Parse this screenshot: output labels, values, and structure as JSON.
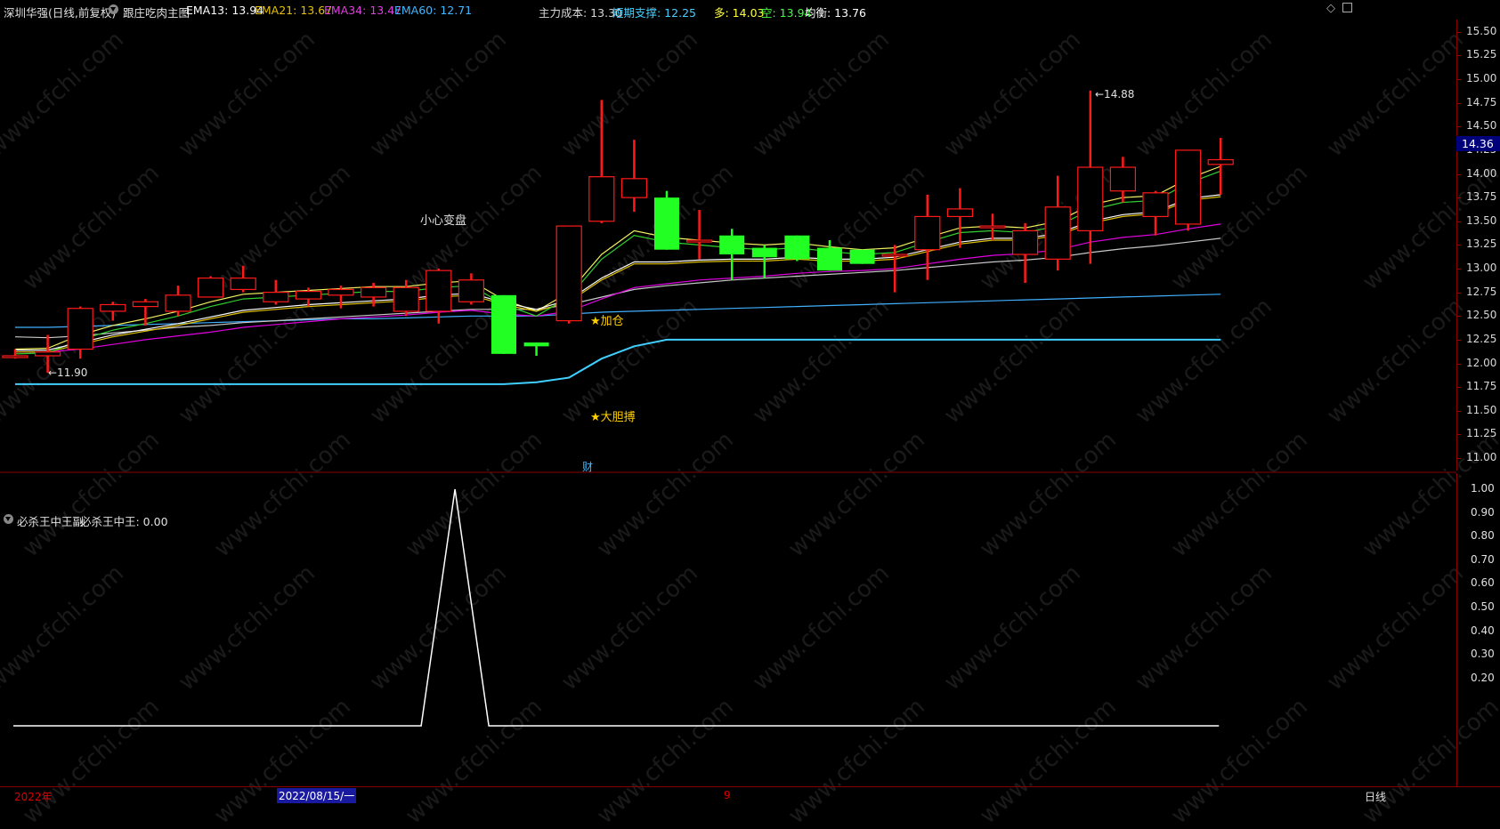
{
  "header": {
    "stock": "深圳华强(日线,前复权)",
    "indicator": "跟庄吃肉主图",
    "ema13": "EMA13: 13.94",
    "ema21": "EMA21: 13.67",
    "ema34": "EMA34: 13.47",
    "ema60": "EMA60: 12.71",
    "main_cost": "主力成本: 13.30",
    "short_support": "短期支撑: 12.25",
    "bull": "多: 14.03",
    "bear": "空: 13.94",
    "balance": "均衡: 13.76"
  },
  "sub_header": {
    "indicator": "必杀王中王副",
    "value": "必杀王中王: 0.00"
  },
  "annotations": {
    "caution": "小心变盘",
    "add_position": "★加仓",
    "bold_fight": "★大胆搏",
    "finance": "财",
    "low_label": "←11.90",
    "high_label": "←14.88"
  },
  "price_axis": [
    "15.50",
    "15.25",
    "15.00",
    "14.75",
    "14.50",
    "14.25",
    "14.00",
    "13.75",
    "13.50",
    "13.25",
    "13.00",
    "12.75",
    "12.50",
    "12.25",
    "12.00",
    "11.75",
    "11.50",
    "11.25",
    "11.00"
  ],
  "current_price": "14.36",
  "sub_axis": [
    "1.00",
    "0.90",
    "0.80",
    "0.70",
    "0.60",
    "0.50",
    "0.40",
    "0.30",
    "0.20"
  ],
  "bottom": {
    "year": "2022年",
    "date": "2022/08/15/一",
    "month": "9",
    "period": "日线"
  },
  "watermark": "www.cfchi.com",
  "colors": {
    "up": "#ff1a1a",
    "down": "#22ff22",
    "ema13": "#f0f000",
    "ema21": "#e0c000",
    "ema34": "#e000e0",
    "ema60": "#40b0ff",
    "support": "#40d0ff"
  },
  "chart_data": {
    "type": "candlestick",
    "ylim": [
      10.9,
      15.6
    ],
    "candles": [
      {
        "o": 12.08,
        "h": 12.15,
        "l": 12.05,
        "c": 12.08
      },
      {
        "o": 12.08,
        "h": 12.3,
        "l": 11.9,
        "c": 12.12
      },
      {
        "o": 12.15,
        "h": 12.6,
        "l": 12.05,
        "c": 12.58
      },
      {
        "o": 12.55,
        "h": 12.65,
        "l": 12.45,
        "c": 12.62
      },
      {
        "o": 12.6,
        "h": 12.68,
        "l": 12.4,
        "c": 12.65
      },
      {
        "o": 12.55,
        "h": 12.82,
        "l": 12.5,
        "c": 12.72
      },
      {
        "o": 12.7,
        "h": 12.92,
        "l": 12.7,
        "c": 12.9
      },
      {
        "o": 12.78,
        "h": 13.03,
        "l": 12.75,
        "c": 12.9
      },
      {
        "o": 12.65,
        "h": 12.88,
        "l": 12.62,
        "c": 12.75
      },
      {
        "o": 12.68,
        "h": 12.8,
        "l": 12.6,
        "c": 12.76
      },
      {
        "o": 12.72,
        "h": 12.82,
        "l": 12.58,
        "c": 12.78
      },
      {
        "o": 12.7,
        "h": 12.85,
        "l": 12.6,
        "c": 12.8
      },
      {
        "o": 12.55,
        "h": 12.88,
        "l": 12.5,
        "c": 12.8
      },
      {
        "o": 12.55,
        "h": 13.0,
        "l": 12.42,
        "c": 12.98
      },
      {
        "o": 12.65,
        "h": 12.95,
        "l": 12.62,
        "c": 12.88
      },
      {
        "o": 12.72,
        "h": 12.72,
        "l": 12.1,
        "c": 12.1
      },
      {
        "o": 12.22,
        "h": 12.22,
        "l": 12.08,
        "c": 12.18
      },
      {
        "o": 12.45,
        "h": 13.45,
        "l": 12.42,
        "c": 13.45
      },
      {
        "o": 13.5,
        "h": 14.78,
        "l": 13.48,
        "c": 13.97
      },
      {
        "o": 13.75,
        "h": 14.36,
        "l": 13.6,
        "c": 13.95
      },
      {
        "o": 13.75,
        "h": 13.82,
        "l": 13.2,
        "c": 13.2
      },
      {
        "o": 13.3,
        "h": 13.62,
        "l": 13.1,
        "c": 13.3
      },
      {
        "o": 13.35,
        "h": 13.42,
        "l": 12.88,
        "c": 13.15
      },
      {
        "o": 13.22,
        "h": 13.25,
        "l": 12.9,
        "c": 13.12
      },
      {
        "o": 13.35,
        "h": 13.35,
        "l": 13.08,
        "c": 13.1
      },
      {
        "o": 13.22,
        "h": 13.3,
        "l": 12.98,
        "c": 12.98
      },
      {
        "o": 13.2,
        "h": 13.2,
        "l": 13.05,
        "c": 13.05
      },
      {
        "o": 13.15,
        "h": 13.25,
        "l": 12.75,
        "c": 13.15
      },
      {
        "o": 13.2,
        "h": 13.78,
        "l": 12.88,
        "c": 13.55
      },
      {
        "o": 13.55,
        "h": 13.85,
        "l": 13.22,
        "c": 13.63
      },
      {
        "o": 13.45,
        "h": 13.58,
        "l": 13.3,
        "c": 13.45
      },
      {
        "o": 13.15,
        "h": 13.48,
        "l": 12.85,
        "c": 13.4
      },
      {
        "o": 13.1,
        "h": 13.98,
        "l": 12.98,
        "c": 13.65
      },
      {
        "o": 13.4,
        "h": 14.88,
        "l": 13.05,
        "c": 14.07
      },
      {
        "o": 13.82,
        "h": 14.18,
        "l": 13.7,
        "c": 14.07
      },
      {
        "o": 13.55,
        "h": 13.82,
        "l": 13.35,
        "c": 13.8
      },
      {
        "o": 13.47,
        "h": 14.25,
        "l": 13.4,
        "c": 14.25
      },
      {
        "o": 14.1,
        "h": 14.38,
        "l": 13.78,
        "c": 14.15
      }
    ],
    "ema13": [
      12.1,
      12.11,
      12.25,
      12.35,
      12.42,
      12.5,
      12.6,
      12.68,
      12.7,
      12.72,
      12.74,
      12.76,
      12.76,
      12.8,
      12.82,
      12.62,
      12.5,
      12.7,
      13.1,
      13.35,
      13.28,
      13.25,
      13.22,
      13.2,
      13.22,
      13.18,
      13.15,
      13.17,
      13.28,
      13.38,
      13.4,
      13.38,
      13.45,
      13.62,
      13.7,
      13.72,
      13.9,
      14.03
    ],
    "ema21": [
      12.12,
      12.12,
      12.2,
      12.28,
      12.34,
      12.4,
      12.47,
      12.54,
      12.57,
      12.6,
      12.62,
      12.64,
      12.66,
      12.7,
      12.72,
      12.62,
      12.55,
      12.65,
      12.88,
      13.05,
      13.05,
      13.07,
      13.08,
      13.08,
      13.1,
      13.08,
      13.08,
      13.1,
      13.18,
      13.26,
      13.3,
      13.3,
      13.35,
      13.48,
      13.55,
      13.58,
      13.72,
      13.76
    ],
    "ema34": [
      12.12,
      12.12,
      12.15,
      12.2,
      12.25,
      12.29,
      12.33,
      12.38,
      12.41,
      12.44,
      12.47,
      12.49,
      12.51,
      12.54,
      12.56,
      12.52,
      12.5,
      12.55,
      12.68,
      12.8,
      12.84,
      12.88,
      12.9,
      12.92,
      12.95,
      12.97,
      12.98,
      13.0,
      13.05,
      13.1,
      13.14,
      13.16,
      13.2,
      13.28,
      13.33,
      13.36,
      13.42,
      13.47
    ],
    "ema60": [
      12.28,
      12.27,
      12.29,
      12.32,
      12.35,
      12.38,
      12.4,
      12.43,
      12.45,
      12.47,
      12.49,
      12.51,
      12.53,
      12.55,
      12.57,
      12.57,
      12.57,
      12.62,
      12.7,
      12.78,
      12.82,
      12.85,
      12.88,
      12.9,
      12.92,
      12.94,
      12.96,
      12.98,
      13.01,
      13.04,
      13.07,
      13.09,
      13.12,
      13.17,
      13.21,
      13.24,
      13.28,
      13.32
    ],
    "support": [
      11.78,
      11.78,
      11.78,
      11.78,
      11.78,
      11.78,
      11.78,
      11.78,
      11.78,
      11.78,
      11.78,
      11.78,
      11.78,
      11.78,
      11.78,
      11.78,
      11.8,
      11.85,
      12.05,
      12.18,
      12.25,
      12.25,
      12.25,
      12.25,
      12.25,
      12.25,
      12.25,
      12.25,
      12.25,
      12.25,
      12.25,
      12.25,
      12.25,
      12.25,
      12.25,
      12.25,
      12.25,
      12.25
    ],
    "main_cost": [
      12.48,
      12.48,
      12.49,
      12.5,
      12.51,
      12.52,
      12.53,
      12.54,
      12.55,
      12.56,
      12.57,
      12.57,
      12.58,
      12.59,
      12.6,
      12.6,
      12.6,
      12.62,
      12.64,
      12.65,
      12.66,
      12.67,
      12.68,
      12.69,
      12.7,
      12.71,
      12.72,
      12.73,
      12.74,
      12.75,
      12.76,
      12.77,
      12.78,
      12.79,
      12.8,
      12.81,
      12.82,
      12.83
    ],
    "sub_series": [
      0,
      0,
      0,
      0,
      0,
      0,
      0,
      0,
      0,
      0,
      0,
      0,
      0,
      0,
      0,
      0,
      0,
      0,
      0,
      0,
      0,
      0,
      0,
      0,
      0,
      0,
      0,
      0,
      0,
      0,
      0,
      0,
      0,
      0,
      0,
      0,
      0,
      0
    ],
    "sub_peak": {
      "index": 13.5,
      "value": 1.0
    }
  }
}
